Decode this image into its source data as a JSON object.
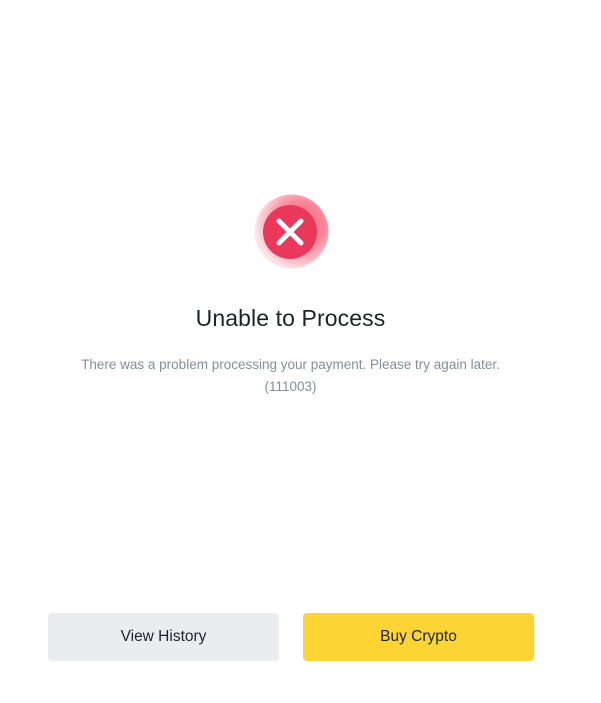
{
  "result": {
    "icon": "error-x-icon",
    "icon_colors": {
      "halo_light": "#ffd5da",
      "halo": "#f7899a",
      "circle": "#e9385a",
      "mark": "#ffffff"
    },
    "title": "Unable to Process",
    "message": "There was a problem processing your payment. Please try again later.",
    "error_code": "(111003)"
  },
  "actions": {
    "view_history_label": "View History",
    "buy_crypto_label": "Buy Crypto",
    "primary_color": "#fcd535",
    "secondary_color": "#eaecef"
  }
}
